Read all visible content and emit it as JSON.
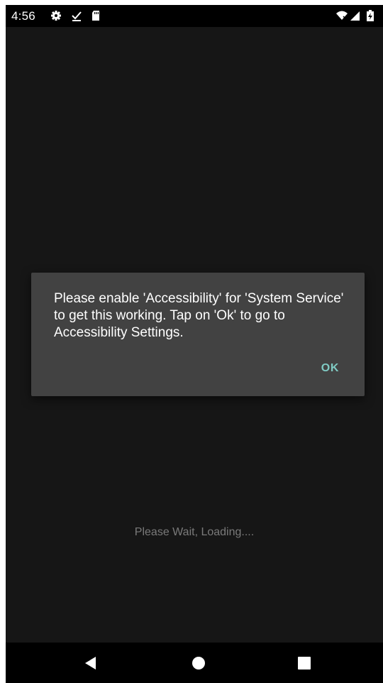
{
  "status_bar": {
    "time": "4:56",
    "icons": [
      "settings-gear-icon",
      "download-done-icon",
      "sd-card-icon",
      "wifi-off-icon",
      "cell-signal-icon",
      "battery-charging-icon"
    ]
  },
  "dialog": {
    "message": "Please enable 'Accessibility' for 'System Service' to get this working. Tap on 'Ok' to go to Accessibility Settings.",
    "ok_label": "OK"
  },
  "loading": {
    "text": "Please Wait, Loading...."
  },
  "nav_bar": {
    "buttons": [
      "back-icon",
      "home-icon",
      "recents-icon"
    ]
  },
  "colors": {
    "background": "#161616",
    "dialog_background": "#424242",
    "accent": "#80cbc4",
    "loading_text": "#7a7a7a"
  }
}
